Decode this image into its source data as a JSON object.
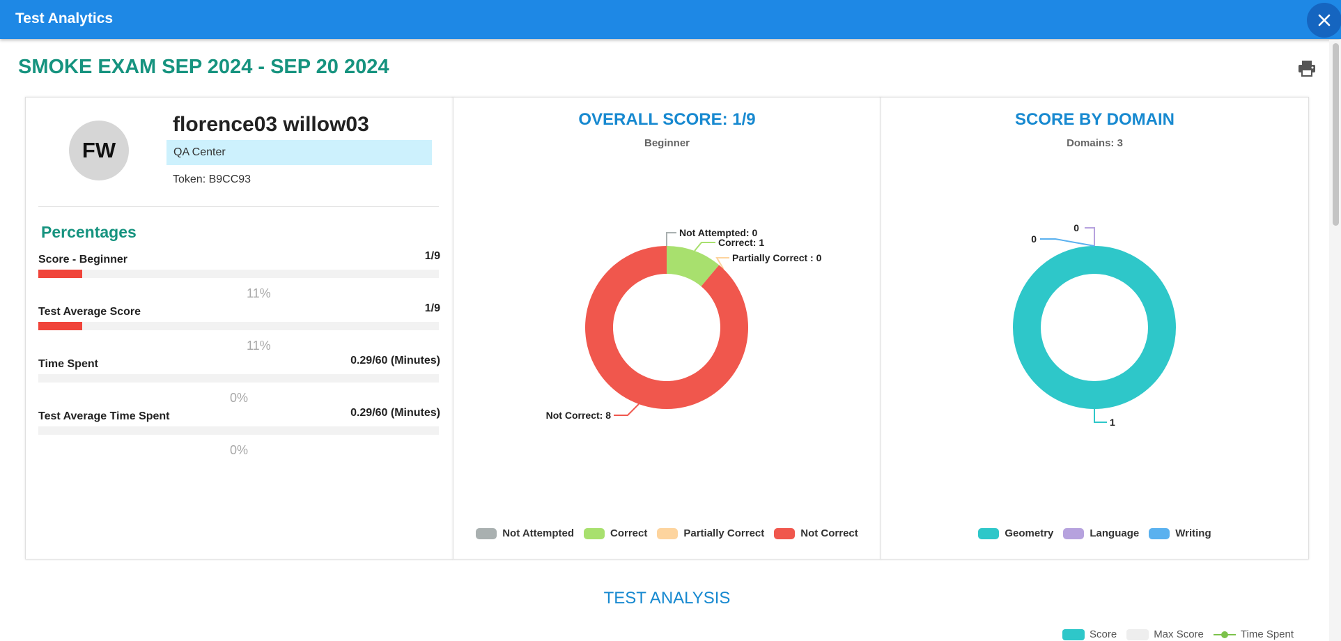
{
  "window": {
    "title": "Test Analytics"
  },
  "exam": {
    "title": "SMOKE EXAM SEP 2024 - SEP 20 2024"
  },
  "profile": {
    "initials": "FW",
    "name": "florence03 willow03",
    "center": "QA Center",
    "token": "Token: B9CC93"
  },
  "percentages": {
    "heading": "Percentages",
    "metrics": [
      {
        "label": "Score - Beginner",
        "value": "1/9",
        "percent": "11%",
        "fraction": 0.11
      },
      {
        "label": "Test Average Score",
        "value": "1/9",
        "percent": "11%",
        "fraction": 0.11
      },
      {
        "label": "Time Spent",
        "value": "0.29/60 (Minutes)",
        "percent": "0%",
        "fraction": 0.0
      },
      {
        "label": "Test Average Time Spent",
        "value": "0.29/60 (Minutes)",
        "percent": "0%",
        "fraction": 0.0
      }
    ]
  },
  "analysis": {
    "title": "TEST ANALYSIS"
  },
  "bottom_legend": [
    "Score",
    "Max Score",
    "Time Spent"
  ],
  "colors": {
    "accent": "#1e88e5",
    "teal_heading": "#16937f",
    "blue_heading": "#1789d0",
    "bar_red": "#f0443a",
    "not_attempted": "#a9b0b0",
    "correct": "#a8e06e",
    "partially_correct": "#fdd49e",
    "not_correct": "#f0574d",
    "geometry": "#2ec7c9",
    "language": "#b6a2de",
    "writing": "#5ab1ef",
    "max_score": "#eeeeee",
    "time_spent": "#7cc24b"
  },
  "chart_data": [
    {
      "type": "pie",
      "donut": true,
      "title": "OVERALL SCORE:  1/9",
      "subtitle": "Beginner",
      "slices": [
        {
          "name": "Not Attempted",
          "value": 0,
          "label": "Not Attempted: 0",
          "color": "#a9b0b0"
        },
        {
          "name": "Correct",
          "value": 1,
          "label": "Correct: 1",
          "color": "#a8e06e"
        },
        {
          "name": "Partially Correct",
          "value": 0,
          "label": "Partially Correct : 0",
          "color": "#fdd49e"
        },
        {
          "name": "Not Correct",
          "value": 8,
          "label": "Not Correct: 8",
          "color": "#f0574d"
        }
      ],
      "legend": "bottom"
    },
    {
      "type": "pie",
      "donut": true,
      "title": "SCORE BY DOMAIN",
      "subtitle": "Domains: 3",
      "slices": [
        {
          "name": "Geometry",
          "value": 1,
          "label": "1",
          "color": "#2ec7c9"
        },
        {
          "name": "Language",
          "value": 0,
          "label": "0",
          "color": "#b6a2de"
        },
        {
          "name": "Writing",
          "value": 0,
          "label": "0",
          "color": "#5ab1ef"
        }
      ],
      "legend": "bottom"
    }
  ]
}
